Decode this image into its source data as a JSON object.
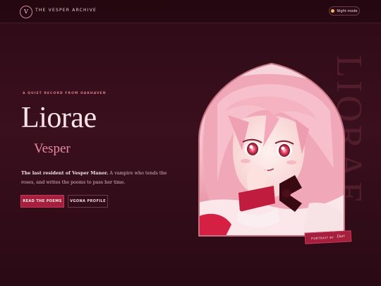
{
  "header": {
    "logo_letter": "V",
    "site_title": "THE VESPER ARCHIVE",
    "night_mode_label": "Night mode"
  },
  "hero": {
    "kicker": "A QUIET RECORD FROM OAKHAVEN",
    "first_name": "Liorae",
    "last_name": "Vesper",
    "bio_lead": "The last resident of Vesper Manor.",
    "bio_rest": " A vampire who tends the roses, and writes the poems to pass her time.",
    "primary_button": "READ THE POEMS",
    "secondary_button": "VGONA PROFILE",
    "watermark": "LIORAE"
  },
  "portrait_credit": {
    "label": "PORTRAIT BY",
    "artist": "Duri"
  },
  "colors": {
    "background": "#2e0b16",
    "accent": "#a61f3c",
    "rose": "#e88ca0",
    "text": "#f6e4e8"
  }
}
